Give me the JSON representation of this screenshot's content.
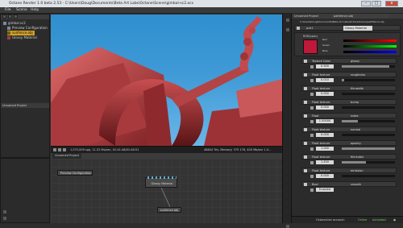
{
  "titlebar": {
    "title": "Octane Render 1.0 beta 2.53 - C:\\Users\\Doug\\Documents\\Beta Art Labs\\Octane\\Scene\\gimbal-sc2.ocs",
    "minimize": "–",
    "maximize": "□",
    "close": "x"
  },
  "menu": [
    "File",
    "Scene",
    "Help"
  ],
  "outliner": {
    "header": "gimbal-sc2",
    "items": [
      {
        "label": "gimbal.sc2",
        "selected": false
      },
      {
        "label": "Preview Configuration",
        "selected": false
      },
      {
        "label": "sunfence.obj",
        "selected": true
      },
      {
        "label": "Glossy Material",
        "selected": false
      }
    ],
    "section": "Unnamed Project"
  },
  "viewport": {
    "status_left": "1,072,009 spp, 11.52 Ms/sec, 01:41:46/01:46:51",
    "status_right": "48844 Tris, Memory: 375 176, 400 Mb/sec 1.0..."
  },
  "node_editor": {
    "tab": "Unnamed Project",
    "nodes": {
      "preview": "Preview Configuration",
      "material": "Glossy Material",
      "mesh": "sunfence.obj"
    }
  },
  "inspector": {
    "breadcrumb": "Unnamed Project",
    "file_field": "pathfence.obj",
    "path": "C:\\Users\\Doug\\Documents\\Beta Art Labs\\Octane\\Scene\\pathfence.obj",
    "node_name": "pcb1",
    "material_type": "Glossy Material",
    "swatch_label": "RGB(spec)",
    "rgb": {
      "r_label": "Red",
      "g_label": "Green",
      "b_label": "Blue"
    },
    "rows": [
      {
        "label": "Texture Color",
        "name": "glossy",
        "value": "0.900",
        "fill": 0.9
      },
      {
        "label": "Float texture",
        "name": "roughness",
        "value": "0.010",
        "fill": 0.05
      },
      {
        "label": "Float texture",
        "name": "filmwidth",
        "value": "0.000",
        "fill": 0.0
      },
      {
        "label": "Float texture",
        "name": "bump",
        "value": "0.000",
        "fill": 0.0
      },
      {
        "label": "Float",
        "name": "index",
        "value": "1.50000",
        "fill": 0.3
      },
      {
        "label": "Float texture",
        "name": "normal",
        "value": "0.000",
        "fill": 0.0
      },
      {
        "label": "Float texture",
        "name": "opacity",
        "value": "1.000",
        "fill": 1.0
      },
      {
        "label": "Float texture",
        "name": "filmindex",
        "value": "1.450",
        "fill": 0.45
      },
      {
        "label": "Float texture",
        "name": "emission",
        "value": "0.000",
        "fill": 0.0
      },
      {
        "label": "Bool",
        "name": "smooth",
        "value": "Enabled",
        "fill": null
      }
    ]
  },
  "status_bar": {
    "text": "OctaneLive account:",
    "state1": "Online",
    "state2": "Activated",
    "indicator": "●"
  },
  "colors": {
    "swatch": "#c0183a",
    "selected": "#d2a022",
    "sky": "#3f9ad6"
  }
}
